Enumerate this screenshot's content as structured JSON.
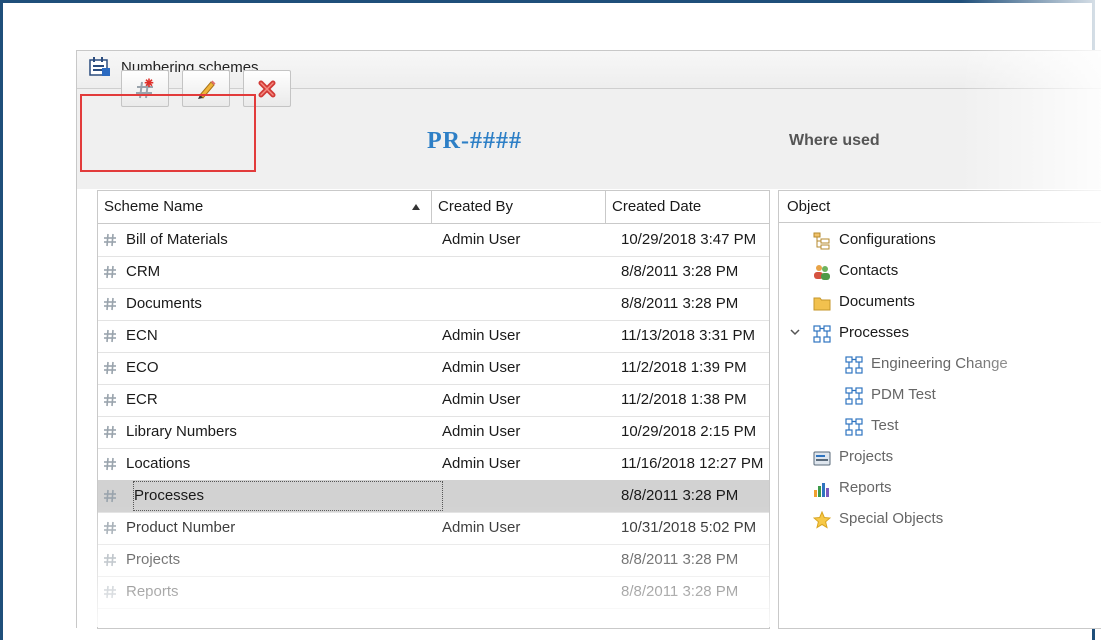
{
  "window": {
    "title": "Numbering schemes"
  },
  "toolbar": {
    "buttons": [
      {
        "name": "add-scheme-button",
        "icon": "add-hash-icon"
      },
      {
        "name": "edit-scheme-button",
        "icon": "pencil-icon"
      },
      {
        "name": "delete-scheme-button",
        "icon": "delete-x-icon"
      }
    ]
  },
  "preview": {
    "code": "PR-####"
  },
  "where_used": {
    "label": "Where used"
  },
  "grid": {
    "columns": [
      "Scheme Name",
      "Created By",
      "Created Date"
    ],
    "sort_column": "Scheme Name",
    "rows": [
      {
        "name": "Bill of Materials",
        "by": "Admin User",
        "date": "10/29/2018 3:47 PM"
      },
      {
        "name": "CRM",
        "by": "",
        "date": "8/8/2011 3:28 PM"
      },
      {
        "name": "Documents",
        "by": "",
        "date": "8/8/2011 3:28 PM"
      },
      {
        "name": "ECN",
        "by": "Admin User",
        "date": "11/13/2018 3:31 PM"
      },
      {
        "name": "ECO",
        "by": "Admin User",
        "date": "11/2/2018 1:39 PM"
      },
      {
        "name": "ECR",
        "by": "Admin User",
        "date": "11/2/2018 1:38 PM"
      },
      {
        "name": "Library Numbers",
        "by": "Admin User",
        "date": "10/29/2018 2:15 PM"
      },
      {
        "name": "Locations",
        "by": "Admin User",
        "date": "11/16/2018 12:27 PM"
      },
      {
        "name": "Processes",
        "by": "",
        "date": "8/8/2011 3:28 PM"
      },
      {
        "name": "Product Number",
        "by": "Admin User",
        "date": "10/31/2018 5:02 PM"
      },
      {
        "name": "Projects",
        "by": "",
        "date": "8/8/2011 3:28 PM"
      },
      {
        "name": "Reports",
        "by": "",
        "date": "8/8/2011 3:28 PM"
      }
    ],
    "selected_index": 8
  },
  "tree": {
    "header": "Object",
    "nodes": [
      {
        "label": "Configurations",
        "icon": "configurations-icon",
        "level": 0,
        "expander": ""
      },
      {
        "label": "Contacts",
        "icon": "contacts-icon",
        "level": 0,
        "expander": ""
      },
      {
        "label": "Documents",
        "icon": "folder-icon",
        "level": 0,
        "expander": ""
      },
      {
        "label": "Processes",
        "icon": "process-icon",
        "level": 0,
        "expander": "expanded"
      },
      {
        "label": "Engineering Change",
        "icon": "process-icon",
        "level": 1,
        "expander": ""
      },
      {
        "label": "PDM Test",
        "icon": "process-icon",
        "level": 1,
        "expander": ""
      },
      {
        "label": "Test",
        "icon": "process-icon",
        "level": 1,
        "expander": ""
      },
      {
        "label": "Projects",
        "icon": "projects-icon",
        "level": 0,
        "expander": ""
      },
      {
        "label": "Reports",
        "icon": "reports-icon",
        "level": 0,
        "expander": ""
      },
      {
        "label": "Special Objects",
        "icon": "star-icon",
        "level": 0,
        "expander": ""
      }
    ]
  },
  "colors": {
    "frame_border": "#1f4f7a",
    "scheme_code": "#2d7fc6",
    "highlight": "#e23b3b",
    "selected_row": "#d2d2d2"
  }
}
